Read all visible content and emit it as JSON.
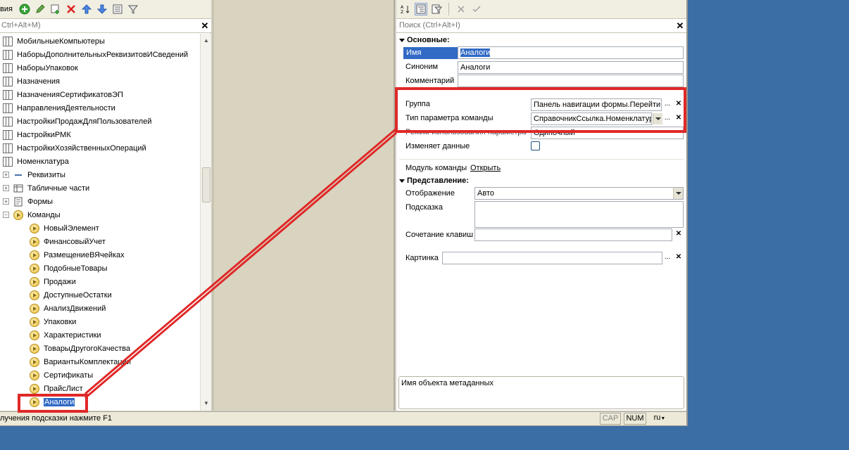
{
  "left_panel": {
    "toolbar": {
      "menu_label": "вия"
    },
    "search": {
      "placeholder": "Ctrl+Alt+M)"
    },
    "tree": [
      {
        "label": "МобильныеКомпьютеры",
        "kind": "table"
      },
      {
        "label": "НаборыДополнительныхРеквизитовИСведений",
        "kind": "table"
      },
      {
        "label": "НаборыУпаковок",
        "kind": "table"
      },
      {
        "label": "Назначения",
        "kind": "table"
      },
      {
        "label": "НазначенияСертификатовЭП",
        "kind": "table"
      },
      {
        "label": "НаправленияДеятельности",
        "kind": "table"
      },
      {
        "label": "НастройкиПродажДляПользователей",
        "kind": "table"
      },
      {
        "label": "НастройкиРМК",
        "kind": "table"
      },
      {
        "label": "НастройкиХозяйственныхОпераций",
        "kind": "table"
      },
      {
        "label": "Номенклатура",
        "kind": "table"
      },
      {
        "label": "Реквизиты",
        "kind": "group"
      },
      {
        "label": "Табличные части",
        "kind": "group"
      },
      {
        "label": "Формы",
        "kind": "group"
      },
      {
        "label": "Команды",
        "kind": "group-open"
      },
      {
        "label": "НовыйЭлемент",
        "kind": "command"
      },
      {
        "label": "ФинансовыйУчет",
        "kind": "command"
      },
      {
        "label": "РазмещениеВЯчейках",
        "kind": "command"
      },
      {
        "label": "ПодобныеТовары",
        "kind": "command"
      },
      {
        "label": "Продажи",
        "kind": "command"
      },
      {
        "label": "ДоступныеОстатки",
        "kind": "command"
      },
      {
        "label": "АнализДвижений",
        "kind": "command"
      },
      {
        "label": "Упаковки",
        "kind": "command"
      },
      {
        "label": "Характеристики",
        "kind": "command"
      },
      {
        "label": "ТоварыДругогоКачества",
        "kind": "command"
      },
      {
        "label": "ВариантыКомплектации",
        "kind": "command"
      },
      {
        "label": "Сертификаты",
        "kind": "command"
      },
      {
        "label": "ПрайсЛист",
        "kind": "command"
      },
      {
        "label": "Аналоги",
        "kind": "command-selected"
      }
    ]
  },
  "props_panel": {
    "search": {
      "placeholder": "Поиск (Ctrl+Alt+I)"
    },
    "section_main": "Основные:",
    "name_label": "Имя",
    "name_value": "Аналоги",
    "synonym_label": "Синоним",
    "synonym_value": "Аналоги",
    "comment_label": "Комментарий",
    "comment_value": "",
    "group_label": "Группа",
    "group_value": "Панель навигации формы.Перейти",
    "param_type_label": "Тип параметра команды",
    "param_type_value": "СправочникСсылка.Номенклатура",
    "param_mode_label": "Режим использования параметра",
    "param_mode_value": "Одиночный",
    "modifies_data_label": "Изменяет данные",
    "modifies_data_checked": false,
    "module_label": "Модуль команды",
    "module_link": "Открыть",
    "section_view": "Представление:",
    "display_label": "Отображение",
    "display_value": "Авто",
    "tooltip_label": "Подсказка",
    "tooltip_value": "",
    "shortcut_label": "Сочетание клавиш",
    "shortcut_value": "",
    "picture_label": "Картинка",
    "picture_value": "",
    "description": "Имя объекта метаданных",
    "ellipsis": "...",
    "clear": "✕"
  },
  "status_bar": {
    "hint": "лучения подсказки нажмите F1",
    "cap": "CAP",
    "num": "NUM",
    "lang": "ru"
  },
  "colors": {
    "desktop": "#3a6ea5",
    "selection": "#316ac5",
    "annotation": "#e02828"
  }
}
